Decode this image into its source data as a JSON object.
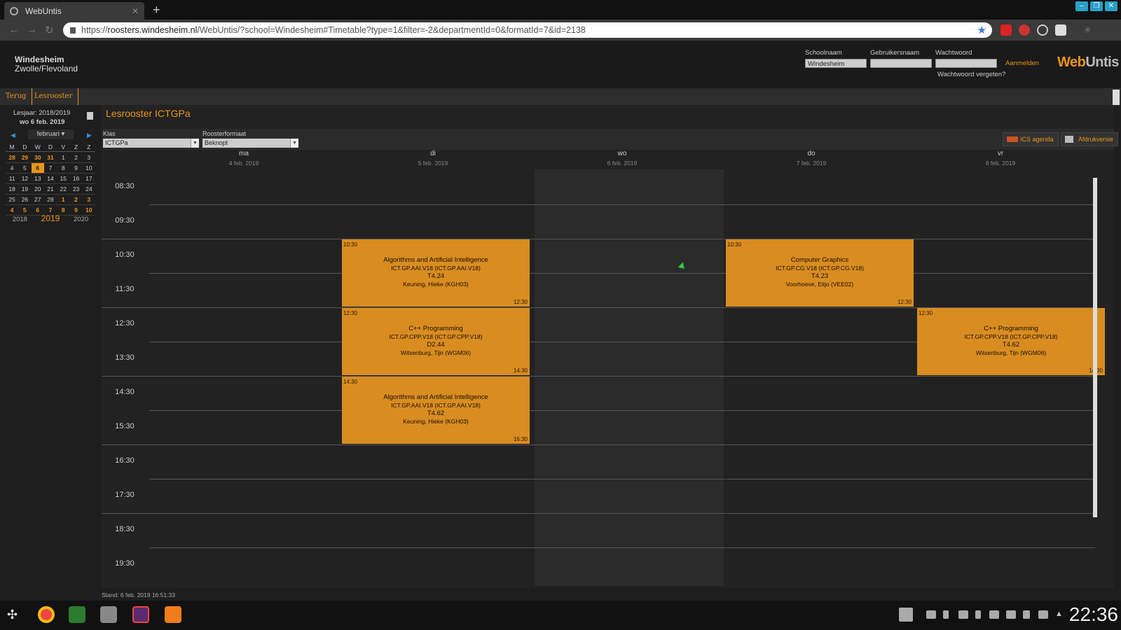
{
  "browser": {
    "tab_title": "WebUntis",
    "url_prefix": "https://",
    "url_host": "roosters.windesheim.nl",
    "url_path": "/WebUntis/?school=Windesheim#Timetable?type=1&filter=-2&departmentId=0&formatId=7&id=2138"
  },
  "header": {
    "org_name": "Windesheim",
    "org_location": "Zwolle/Flevoland",
    "school_label": "Schoolnaam",
    "school_value": "Windesheim",
    "user_label": "Gebruikersnaam",
    "user_value": "",
    "password_label": "Wachtwoord",
    "login_label": "Aanmelden",
    "forgot_label": "Wachtwoord vergeten?",
    "logo_web": "Web",
    "logo_untis": "Untis"
  },
  "nav": {
    "back_label": "Terug",
    "timetable_label": "Lesrooster"
  },
  "sidebar": {
    "schoolyear": "Lesjaar: 2018/2019",
    "current_date": "wo 6 feb. 2019",
    "month": "februari",
    "weekdays": [
      "M",
      "D",
      "W",
      "D",
      "V",
      "Z",
      "Z"
    ],
    "weeks": [
      [
        "28",
        "29",
        "30",
        "31",
        "1",
        "2",
        "3"
      ],
      [
        "4",
        "5",
        "6",
        "7",
        "8",
        "9",
        "10"
      ],
      [
        "11",
        "12",
        "13",
        "14",
        "15",
        "16",
        "17"
      ],
      [
        "18",
        "19",
        "20",
        "21",
        "22",
        "23",
        "24"
      ],
      [
        "25",
        "26",
        "27",
        "28",
        "1",
        "2",
        "3"
      ],
      [
        "4",
        "5",
        "6",
        "7",
        "8",
        "9",
        "10"
      ]
    ],
    "years": [
      "2018",
      "2019",
      "2020"
    ]
  },
  "main": {
    "title": "Lesrooster ICTGPa",
    "class_label": "Klas",
    "class_value": "ICTGPa",
    "format_label": "Roosterformaat",
    "format_value": "Beknopt",
    "ics_label": "ICS agenda",
    "print_label": "Afdrukversie",
    "days": [
      {
        "name": "ma",
        "date": "4 feb. 2019"
      },
      {
        "name": "di",
        "date": "5 feb. 2019"
      },
      {
        "name": "wo",
        "date": "6 feb. 2019"
      },
      {
        "name": "do",
        "date": "7 feb. 2019"
      },
      {
        "name": "vr",
        "date": "8 feb. 2019"
      }
    ],
    "times": [
      "08:30",
      "09:30",
      "10:30",
      "11:30",
      "12:30",
      "13:30",
      "14:30",
      "15:30",
      "16:30",
      "17:30",
      "18:30",
      "19:30"
    ],
    "lessons": [
      {
        "start": "10:30",
        "end": "12:30",
        "subject": "Algorithms and Artificial Intelligence",
        "code": "ICT.GP.AAI.V18 (ICT.GP.AAI.V18)",
        "room": "T4.24",
        "teacher": "Keuning, Hieke (KGH03)"
      },
      {
        "start": "12:30",
        "end": "14:30",
        "subject": "C++ Programming",
        "code": "ICT.GP.CPP.V18 (ICT.GP.CPP.V18)",
        "room": "D2.44",
        "teacher": "Witsenburg, Tijn (WGM06)"
      },
      {
        "start": "14:30",
        "end": "16:30",
        "subject": "Algorithms and Artificial Intelligence",
        "code": "ICT.GP.AAI.V18 (ICT.GP.AAI.V18)",
        "room": "T4.62",
        "teacher": "Keuning, Hieke (KGH03)"
      },
      {
        "start": "10:30",
        "end": "12:30",
        "subject": "Computer Graphics",
        "code": "ICT.GP.CG.V18 (ICT.GP.CG.V18)",
        "room": "T4.23",
        "teacher": "Voorhoeve, Eitjo (VEE02)"
      },
      {
        "start": "12:30",
        "end": "14:30",
        "subject": "C++ Programming",
        "code": "ICT.GP.CPP.V18 (ICT.GP.CPP.V18)",
        "room": "T4.62",
        "teacher": "Witsenburg, Tijn (WGM06)"
      }
    ],
    "footer_stand": "Stand: 6 feb. 2019 16:51:33"
  },
  "taskbar": {
    "clock": "22:36"
  },
  "colors": {
    "accent": "#e8961a",
    "lesson": "#d98c1f",
    "today_column": "#2b2b2b"
  }
}
